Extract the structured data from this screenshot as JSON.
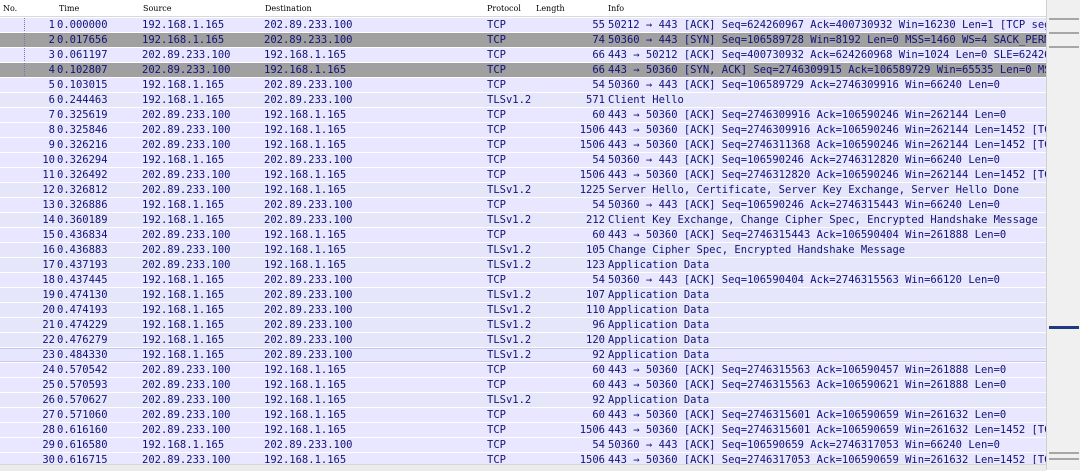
{
  "columns": {
    "no": "No.",
    "time": "Time",
    "source": "Source",
    "destination": "Destination",
    "protocol": "Protocol",
    "length": "Length",
    "info": "Info"
  },
  "colors": {
    "row_default": "#e8e7ff",
    "row_syn": "#a0a0a0",
    "text": "#12127a",
    "scroll_marker": "#1f3a82"
  },
  "packets": [
    {
      "no": "1",
      "time": "0.000000",
      "source": "192.168.1.165",
      "destination": "202.89.233.100",
      "protocol": "TCP",
      "length": "55",
      "info": "50212 → 443 [ACK] Seq=624260967 Ack=400730932 Win=16230 Len=1 [TCP segment",
      "style": "default"
    },
    {
      "no": "2",
      "time": "0.017656",
      "source": "192.168.1.165",
      "destination": "202.89.233.100",
      "protocol": "TCP",
      "length": "74",
      "info": "50360 → 443 [SYN] Seq=106589728 Win=8192 Len=0 MSS=1460 WS=4 SACK_PERM=1",
      "style": "syn"
    },
    {
      "no": "3",
      "time": "0.061197",
      "source": "202.89.233.100",
      "destination": "192.168.1.165",
      "protocol": "TCP",
      "length": "66",
      "info": "443 → 50212 [ACK] Seq=400730932 Ack=624260968 Win=1024 Len=0 SLE=62426096",
      "style": "default"
    },
    {
      "no": "4",
      "time": "0.102807",
      "source": "202.89.233.100",
      "destination": "192.168.1.165",
      "protocol": "TCP",
      "length": "66",
      "info": "443 → 50360 [SYN, ACK] Seq=2746309915 Ack=106589729 Win=65535 Len=0 MSS=14",
      "style": "syn"
    },
    {
      "no": "5",
      "time": "0.103015",
      "source": "192.168.1.165",
      "destination": "202.89.233.100",
      "protocol": "TCP",
      "length": "54",
      "info": "50360 → 443 [ACK] Seq=106589729 Ack=2746309916 Win=66240 Len=0",
      "style": "default"
    },
    {
      "no": "6",
      "time": "0.244463",
      "source": "192.168.1.165",
      "destination": "202.89.233.100",
      "protocol": "TLSv1.2",
      "length": "571",
      "info": "Client Hello",
      "style": "tls"
    },
    {
      "no": "7",
      "time": "0.325619",
      "source": "202.89.233.100",
      "destination": "192.168.1.165",
      "protocol": "TCP",
      "length": "60",
      "info": "443 → 50360 [ACK] Seq=2746309916 Ack=106590246 Win=262144 Len=0",
      "style": "default"
    },
    {
      "no": "8",
      "time": "0.325846",
      "source": "202.89.233.100",
      "destination": "192.168.1.165",
      "protocol": "TCP",
      "length": "1506",
      "info": "443 → 50360 [ACK] Seq=2746309916 Ack=106590246 Win=262144 Len=1452 [TCP se",
      "style": "default"
    },
    {
      "no": "9",
      "time": "0.326216",
      "source": "202.89.233.100",
      "destination": "192.168.1.165",
      "protocol": "TCP",
      "length": "1506",
      "info": "443 → 50360 [ACK] Seq=2746311368 Ack=106590246 Win=262144 Len=1452 [TCP se",
      "style": "default"
    },
    {
      "no": "10",
      "time": "0.326294",
      "source": "192.168.1.165",
      "destination": "202.89.233.100",
      "protocol": "TCP",
      "length": "54",
      "info": "50360 → 443 [ACK] Seq=106590246 Ack=2746312820 Win=66240 Len=0",
      "style": "default"
    },
    {
      "no": "11",
      "time": "0.326492",
      "source": "202.89.233.100",
      "destination": "192.168.1.165",
      "protocol": "TCP",
      "length": "1506",
      "info": "443 → 50360 [ACK] Seq=2746312820 Ack=106590246 Win=262144 Len=1452 [TCP se",
      "style": "default"
    },
    {
      "no": "12",
      "time": "0.326812",
      "source": "202.89.233.100",
      "destination": "192.168.1.165",
      "protocol": "TLSv1.2",
      "length": "1225",
      "info": "Server Hello, Certificate, Server Key Exchange, Server Hello Done",
      "style": "tls"
    },
    {
      "no": "13",
      "time": "0.326886",
      "source": "192.168.1.165",
      "destination": "202.89.233.100",
      "protocol": "TCP",
      "length": "54",
      "info": "50360 → 443 [ACK] Seq=106590246 Ack=2746315443 Win=66240 Len=0",
      "style": "default"
    },
    {
      "no": "14",
      "time": "0.360189",
      "source": "192.168.1.165",
      "destination": "202.89.233.100",
      "protocol": "TLSv1.2",
      "length": "212",
      "info": "Client Key Exchange, Change Cipher Spec, Encrypted Handshake Message",
      "style": "tls"
    },
    {
      "no": "15",
      "time": "0.436834",
      "source": "202.89.233.100",
      "destination": "192.168.1.165",
      "protocol": "TCP",
      "length": "60",
      "info": "443 → 50360 [ACK] Seq=2746315443 Ack=106590404 Win=261888 Len=0",
      "style": "default"
    },
    {
      "no": "16",
      "time": "0.436883",
      "source": "202.89.233.100",
      "destination": "192.168.1.165",
      "protocol": "TLSv1.2",
      "length": "105",
      "info": "Change Cipher Spec, Encrypted Handshake Message",
      "style": "tls"
    },
    {
      "no": "17",
      "time": "0.437193",
      "source": "202.89.233.100",
      "destination": "192.168.1.165",
      "protocol": "TLSv1.2",
      "length": "123",
      "info": "Application Data",
      "style": "tls"
    },
    {
      "no": "18",
      "time": "0.437445",
      "source": "192.168.1.165",
      "destination": "202.89.233.100",
      "protocol": "TCP",
      "length": "54",
      "info": "50360 → 443 [ACK] Seq=106590404 Ack=2746315563 Win=66120 Len=0",
      "style": "default"
    },
    {
      "no": "19",
      "time": "0.474130",
      "source": "192.168.1.165",
      "destination": "202.89.233.100",
      "protocol": "TLSv1.2",
      "length": "107",
      "info": "Application Data",
      "style": "tls"
    },
    {
      "no": "20",
      "time": "0.474193",
      "source": "192.168.1.165",
      "destination": "202.89.233.100",
      "protocol": "TLSv1.2",
      "length": "110",
      "info": "Application Data",
      "style": "tls"
    },
    {
      "no": "21",
      "time": "0.474229",
      "source": "192.168.1.165",
      "destination": "202.89.233.100",
      "protocol": "TLSv1.2",
      "length": "96",
      "info": "Application Data",
      "style": "tls"
    },
    {
      "no": "22",
      "time": "0.476279",
      "source": "192.168.1.165",
      "destination": "202.89.233.100",
      "protocol": "TLSv1.2",
      "length": "120",
      "info": "Application Data",
      "style": "tls"
    },
    {
      "no": "23",
      "time": "0.484330",
      "source": "192.168.1.165",
      "destination": "202.89.233.100",
      "protocol": "TLSv1.2",
      "length": "92",
      "info": "Application Data",
      "style": "selected"
    },
    {
      "no": "24",
      "time": "0.570542",
      "source": "202.89.233.100",
      "destination": "192.168.1.165",
      "protocol": "TCP",
      "length": "60",
      "info": "443 → 50360 [ACK] Seq=2746315563 Ack=106590457 Win=261888 Len=0",
      "style": "default"
    },
    {
      "no": "25",
      "time": "0.570593",
      "source": "202.89.233.100",
      "destination": "192.168.1.165",
      "protocol": "TCP",
      "length": "60",
      "info": "443 → 50360 [ACK] Seq=2746315563 Ack=106590621 Win=261888 Len=0",
      "style": "default"
    },
    {
      "no": "26",
      "time": "0.570627",
      "source": "202.89.233.100",
      "destination": "192.168.1.165",
      "protocol": "TLSv1.2",
      "length": "92",
      "info": "Application Data",
      "style": "tls"
    },
    {
      "no": "27",
      "time": "0.571060",
      "source": "202.89.233.100",
      "destination": "192.168.1.165",
      "protocol": "TCP",
      "length": "60",
      "info": "443 → 50360 [ACK] Seq=2746315601 Ack=106590659 Win=261632 Len=0",
      "style": "default"
    },
    {
      "no": "28",
      "time": "0.616160",
      "source": "202.89.233.100",
      "destination": "192.168.1.165",
      "protocol": "TCP",
      "length": "1506",
      "info": "443 → 50360 [ACK] Seq=2746315601 Ack=106590659 Win=261632 Len=1452 [TCP se",
      "style": "default"
    },
    {
      "no": "29",
      "time": "0.616580",
      "source": "192.168.1.165",
      "destination": "202.89.233.100",
      "protocol": "TCP",
      "length": "54",
      "info": "50360 → 443 [ACK] Seq=106590659 Ack=2746317053 Win=66240 Len=0",
      "style": "default"
    },
    {
      "no": "30",
      "time": "0.616715",
      "source": "202.89.233.100",
      "destination": "192.168.1.165",
      "protocol": "TCP",
      "length": "1506",
      "info": "443 → 50360 [ACK] Seq=2746317053 Ack=106590659 Win=261632 Len=1452 [TCP se",
      "style": "default"
    }
  ]
}
